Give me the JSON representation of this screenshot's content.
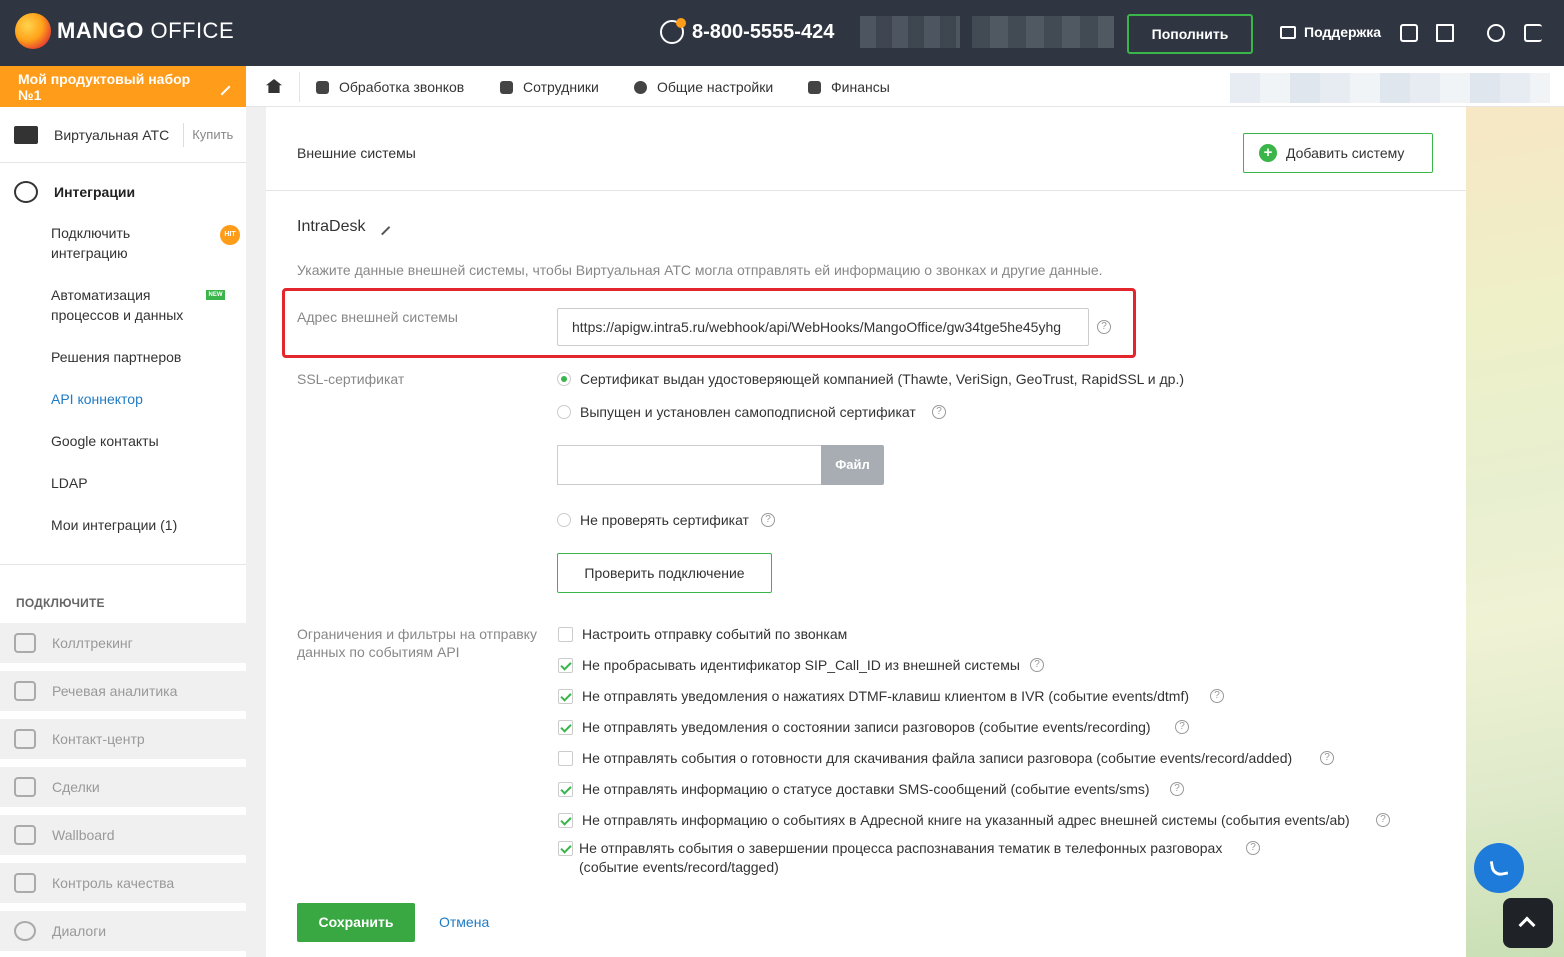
{
  "header": {
    "logo_bold": "MANGO",
    "logo_light": "OFFICE",
    "phone": "8-800-5555-424",
    "topup_label": "Пополнить",
    "support_label": "Поддержка"
  },
  "sidebar": {
    "product_bar": "Мой продуктовый набор №1",
    "vats_label": "Виртуальная АТС",
    "buy_label": "Купить",
    "integrations_label": "Интеграции",
    "items": [
      {
        "label": "Подключить\nинтеграцию",
        "badge": "HIT"
      },
      {
        "label": "Автоматизация\nпроцессов и данных",
        "badge": "NEW"
      },
      {
        "label": "Решения партнеров"
      },
      {
        "label": "API коннектор",
        "active": true
      },
      {
        "label": "Google контакты"
      },
      {
        "label": "LDAP"
      },
      {
        "label": "Мои интеграции (1)"
      }
    ],
    "connect_title": "ПОДКЛЮЧИТЕ",
    "connect_items": [
      "Коллтрекинг",
      "Речевая аналитика",
      "Контакт-центр",
      "Сделки",
      "Wallboard",
      "Контроль качества",
      "Диалоги"
    ]
  },
  "nav": {
    "items": [
      "Обработка звонков",
      "Сотрудники",
      "Общие настройки",
      "Финансы"
    ]
  },
  "page": {
    "title": "Внешние системы",
    "add_button": "Добавить систему",
    "system_name": "IntraDesk",
    "hint": "Укажите данные внешней системы, чтобы Виртуальная АТС могла отправлять ей информацию о звонках и другие данные.",
    "address_label": "Адрес внешней системы",
    "address_value": "https://apigw.intra5.ru/webhook/api/WebHooks/MangoOffice/gw34tge5he45yhg",
    "ssl_label": "SSL-сертификат",
    "ssl_options": [
      "Сертификат выдан удостоверяющей компанией (Thawte, VeriSign, GeoTrust, RapidSSL и др.)",
      "Выпущен и установлен самоподписной сертификат",
      "Не проверять сертификат"
    ],
    "file_button": "Файл",
    "check_button": "Проверить подключение",
    "filters_label": "Ограничения и фильтры на отправку данных по событиям API",
    "filters": [
      {
        "label": "Настроить отправку событий по звонкам",
        "checked": false
      },
      {
        "label": "Не пробрасывать идентификатор SIP_Call_ID из внешней системы",
        "checked": true
      },
      {
        "label": "Не отправлять уведомления о нажатиях DTMF-клавиш клиентом в IVR (событие events/dtmf)",
        "checked": true
      },
      {
        "label": "Не отправлять уведомления о состоянии записи разговоров (событие events/recording)",
        "checked": true
      },
      {
        "label": "Не отправлять события о готовности для скачивания файла записи разговора (событие events/record/added)",
        "checked": false
      },
      {
        "label": "Не отправлять информацию о статусе доставки SMS-сообщений (событие events/sms)",
        "checked": true
      },
      {
        "label": "Не отправлять информацию о событиях в Адресной книге на указанный адрес внешней системы (события events/ab)",
        "checked": true
      },
      {
        "label": "Не отправлять события о завершении процесса распознавания тематик в телефонных разговорах",
        "label2": "(событие events/record/tagged)",
        "checked": true
      }
    ],
    "save_button": "Сохранить",
    "cancel_button": "Отмена"
  },
  "colors": {
    "topbar": "#2f3641",
    "accent_green": "#39b54a",
    "product_orange": "#ff9c1a",
    "link_blue": "#1e7bc4",
    "highlight_red": "#e2262c"
  }
}
